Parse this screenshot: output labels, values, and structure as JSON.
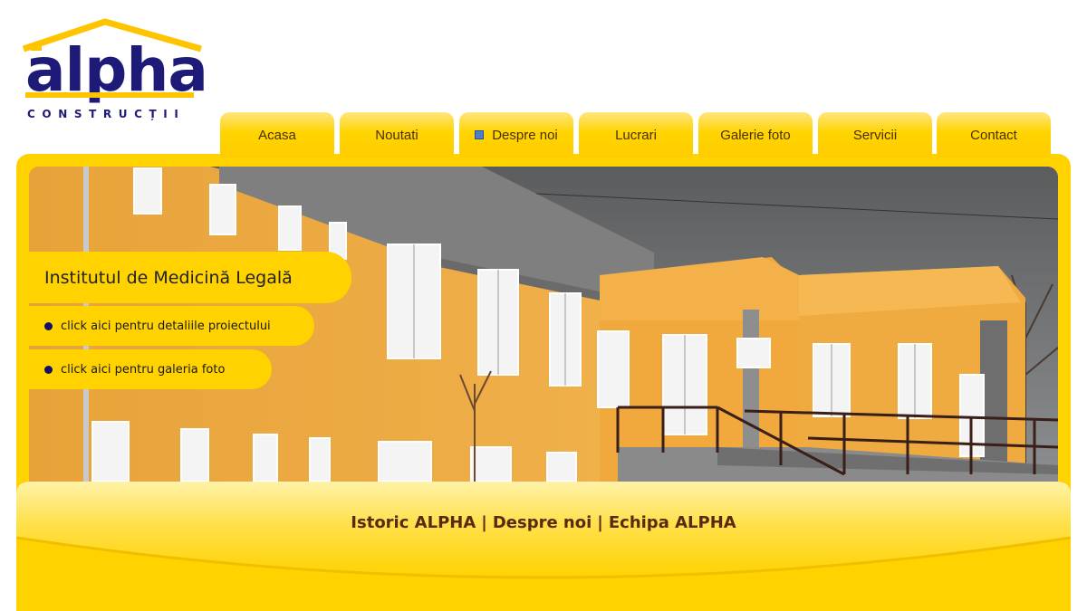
{
  "logo": {
    "word": "alpha",
    "subtitle": "CONSTRUCȚII"
  },
  "nav": {
    "tabs": [
      {
        "label": "Acasa"
      },
      {
        "label": "Noutati"
      },
      {
        "label": "Despre noi",
        "active": true
      },
      {
        "label": "Lucrari"
      },
      {
        "label": "Galerie foto"
      },
      {
        "label": "Servicii"
      },
      {
        "label": "Contact"
      }
    ]
  },
  "project": {
    "title": "Institutul de Medicină Legală",
    "details_link": "click aici pentru detaliile proiectului",
    "gallery_link": "click aici pentru galeria foto"
  },
  "footer": {
    "links": [
      "Istoric ALPHA",
      "Despre noi",
      "Echipa ALPHA"
    ],
    "separator": "|"
  },
  "colors": {
    "brand_yellow": "#ffd200",
    "logo_blue": "#1e1a78",
    "footer_text": "#5a2a10"
  }
}
